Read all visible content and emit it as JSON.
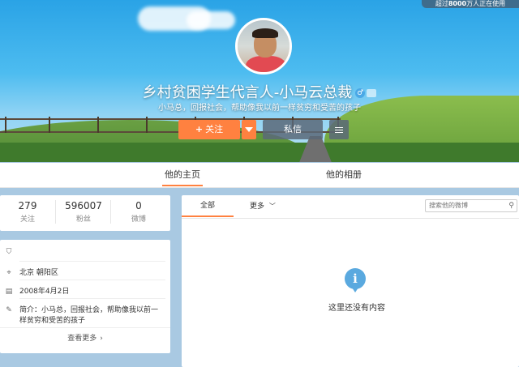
{
  "top_badge": {
    "prefix": "超过",
    "count": "8000",
    "suffix": "万人正在使用"
  },
  "profile": {
    "name": "乡村贫困学生代言人-小马云总裁",
    "gender_icon": "male-icon",
    "gender_symbol": "♂",
    "description": "小马总，回报社会，帮助像我以前一样贫穷和受苦的孩子"
  },
  "actions": {
    "follow_label": "关注",
    "follow_plus": "+",
    "message_label": "私信"
  },
  "tabs": {
    "home": "他的主页",
    "album": "他的相册"
  },
  "stats": [
    {
      "value": "279",
      "label": "关注"
    },
    {
      "value": "596007",
      "label": "粉丝"
    },
    {
      "value": "0",
      "label": "微博"
    }
  ],
  "info": {
    "location": "北京 朝阳区",
    "birthday": "2008年4月2日",
    "bio": "简介：小马总，回报社会，帮助像我以前一",
    "bio_cont": "样贫穷和受苦的孩子",
    "see_more": "查看更多",
    "see_more_arrow": "›"
  },
  "feed": {
    "tab_all": "全部",
    "tab_more": "更多",
    "search_placeholder": "搜索他的微博",
    "empty_icon": "i",
    "empty_text": "这里还没有内容"
  },
  "colors": {
    "accent": "#ff8140",
    "info_blue": "#5aa9df"
  }
}
